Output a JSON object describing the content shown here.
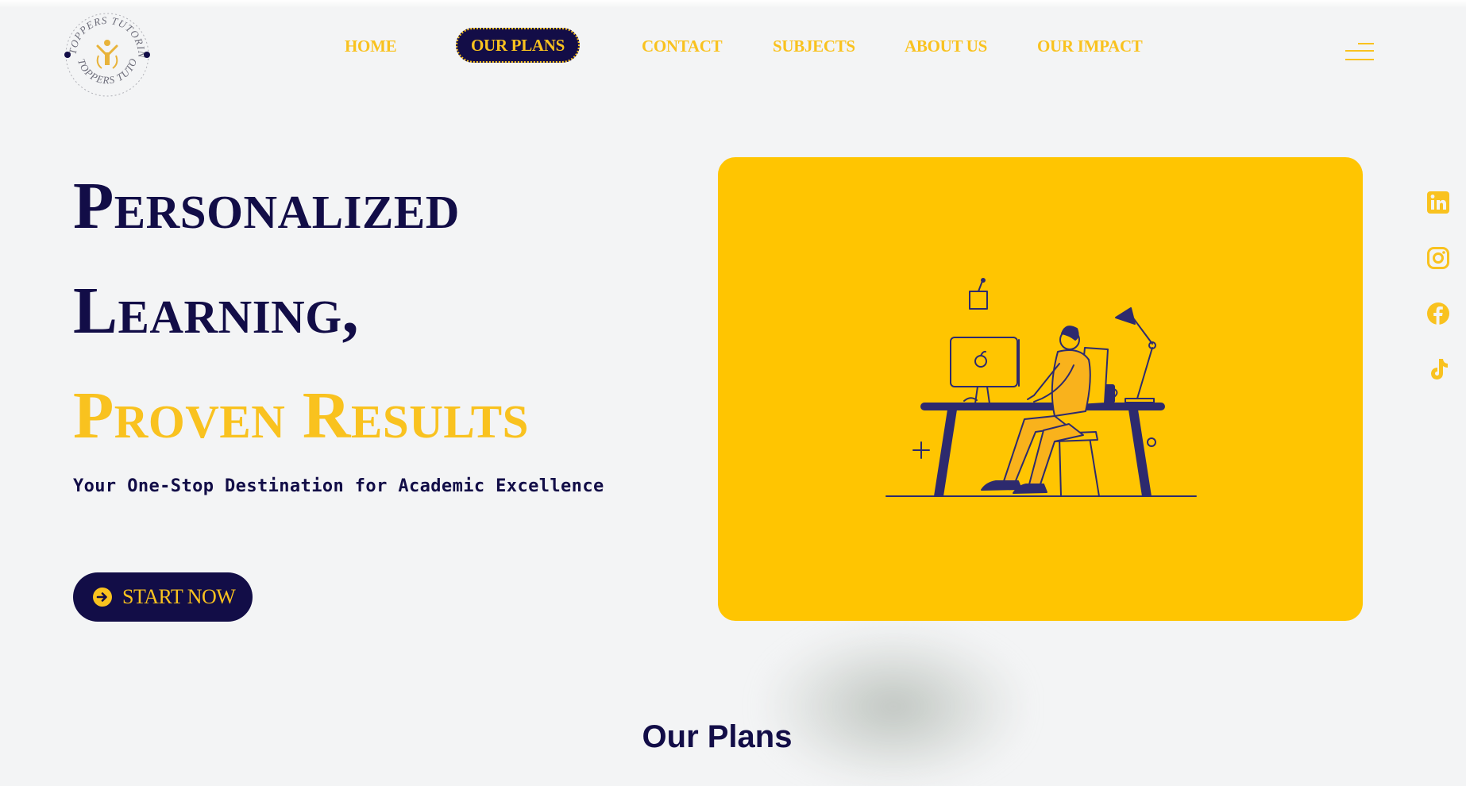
{
  "brand": {
    "logo_text": "TOPPERS TUTORING"
  },
  "nav": {
    "items": [
      {
        "label": "HOME"
      },
      {
        "label": "OUR PLANS",
        "active": true
      },
      {
        "label": "CONTACT"
      },
      {
        "label": "SUBJECTS"
      },
      {
        "label": "ABOUT US"
      },
      {
        "label": "OUR IMPACT"
      }
    ],
    "menu_icon": "hamburger-menu-icon"
  },
  "hero": {
    "line1": "Personalized",
    "line2": "Learning,",
    "line3": "Proven Results",
    "tagline": "Your One-Stop Destination for Academic Excellence",
    "cta_label": "START NOW",
    "cta_icon": "arrow-right-circle-icon"
  },
  "socials": [
    {
      "icon": "linkedin-icon"
    },
    {
      "icon": "instagram-icon"
    },
    {
      "icon": "facebook-icon"
    },
    {
      "icon": "tiktok-icon"
    }
  ],
  "plans": {
    "title": "Our Plans"
  },
  "colors": {
    "navy": "#120d47",
    "gold": "#f9c21f",
    "card_yellow": "#ffc501",
    "background": "#f3f4f5"
  }
}
